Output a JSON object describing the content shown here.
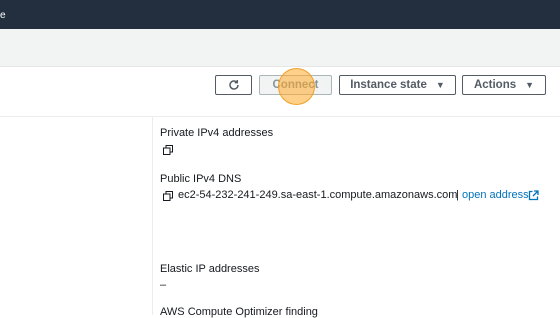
{
  "topbar": {
    "fragment": "e"
  },
  "toolbar": {
    "refresh_icon": "refresh-icon",
    "connect_label": "Connect",
    "instance_state_label": "Instance state",
    "actions_label": "Actions",
    "caret_glyph": "▼"
  },
  "details": {
    "private_ipv4": {
      "label": "Private IPv4 addresses",
      "value": ""
    },
    "public_dns": {
      "label": "Public IPv4 DNS",
      "value": "ec2-54-232-241-249.sa-east-1.compute.amazonaws.com",
      "separator": "|",
      "link_label": "open address"
    },
    "elastic_ip": {
      "label": "Elastic IP addresses",
      "value": "–"
    },
    "compute_optimizer": {
      "label": "AWS Compute Optimizer finding"
    }
  },
  "colors": {
    "topbar": "#232f3e",
    "link": "#0073bb",
    "cursor_highlight": "#ffaa28"
  }
}
